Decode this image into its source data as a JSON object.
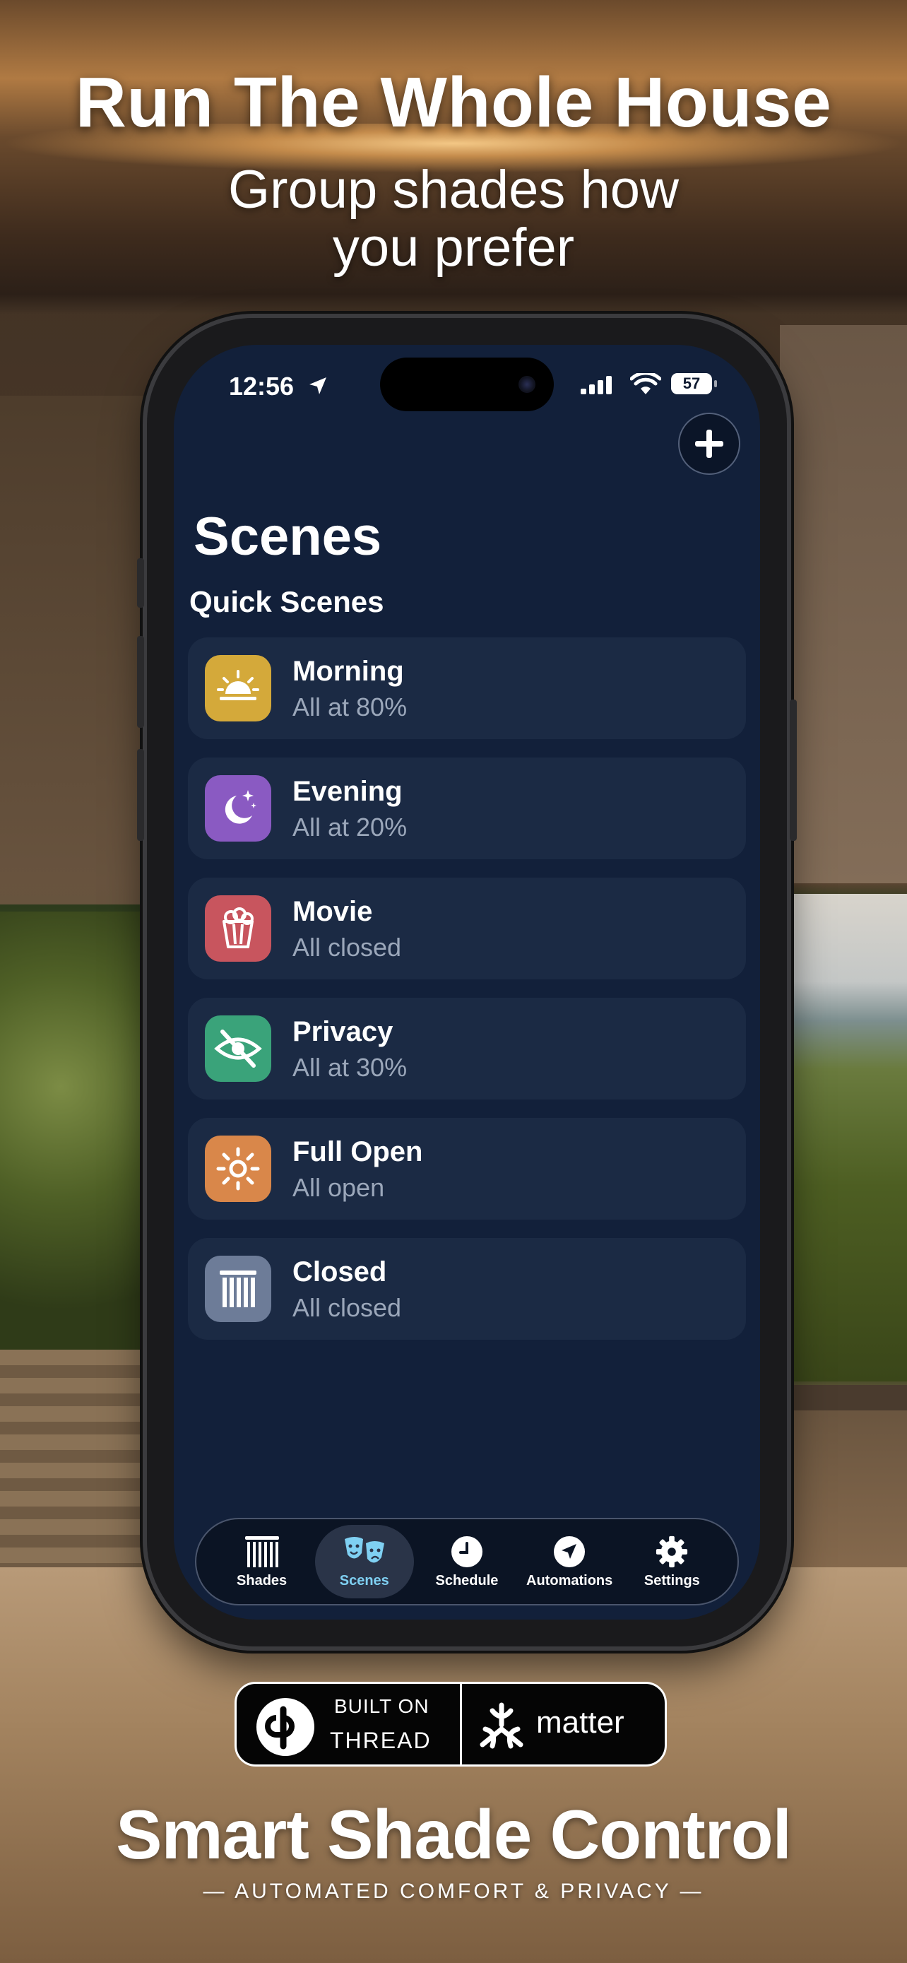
{
  "promo": {
    "headline": "Run The Whole House",
    "subline_1": "Group shades how",
    "subline_2": "you prefer",
    "brand": "Smart Shade Control",
    "tagline": "— AUTOMATED COMFORT & PRIVACY —",
    "badge": {
      "built_on": "BUILT ON",
      "thread": "THREAD",
      "matter": "matter"
    }
  },
  "status_bar": {
    "time": "12:56",
    "battery": "57"
  },
  "screen": {
    "title": "Scenes",
    "section_title": "Quick Scenes",
    "add_icon": "plus-icon"
  },
  "scenes": [
    {
      "name": "Morning",
      "detail": "All at 80%",
      "icon": "sunrise-icon",
      "color": "#d4a93a"
    },
    {
      "name": "Evening",
      "detail": "All at 20%",
      "icon": "moon-stars-icon",
      "color": "#8a5ac2"
    },
    {
      "name": "Movie",
      "detail": "All closed",
      "icon": "popcorn-icon",
      "color": "#c8555e"
    },
    {
      "name": "Privacy",
      "detail": "All at 30%",
      "icon": "eye-slash-icon",
      "color": "#3aa37a"
    },
    {
      "name": "Full Open",
      "detail": "All open",
      "icon": "sun-icon",
      "color": "#d9874a"
    },
    {
      "name": "Closed",
      "detail": "All closed",
      "icon": "blinds-closed-icon",
      "color": "#6d7c98"
    }
  ],
  "tabs": [
    {
      "label": "Shades",
      "icon": "blinds-icon",
      "active": false
    },
    {
      "label": "Scenes",
      "icon": "theater-masks-icon",
      "active": true
    },
    {
      "label": "Schedule",
      "icon": "clock-icon",
      "active": false
    },
    {
      "label": "Automations",
      "icon": "location-arrow-icon",
      "active": false
    },
    {
      "label": "Settings",
      "icon": "gear-icon",
      "active": false
    }
  ],
  "colors": {
    "screen_bg": "#12203a",
    "card_bg": "#1b2a44",
    "active_tab": "#7fd0f2"
  }
}
